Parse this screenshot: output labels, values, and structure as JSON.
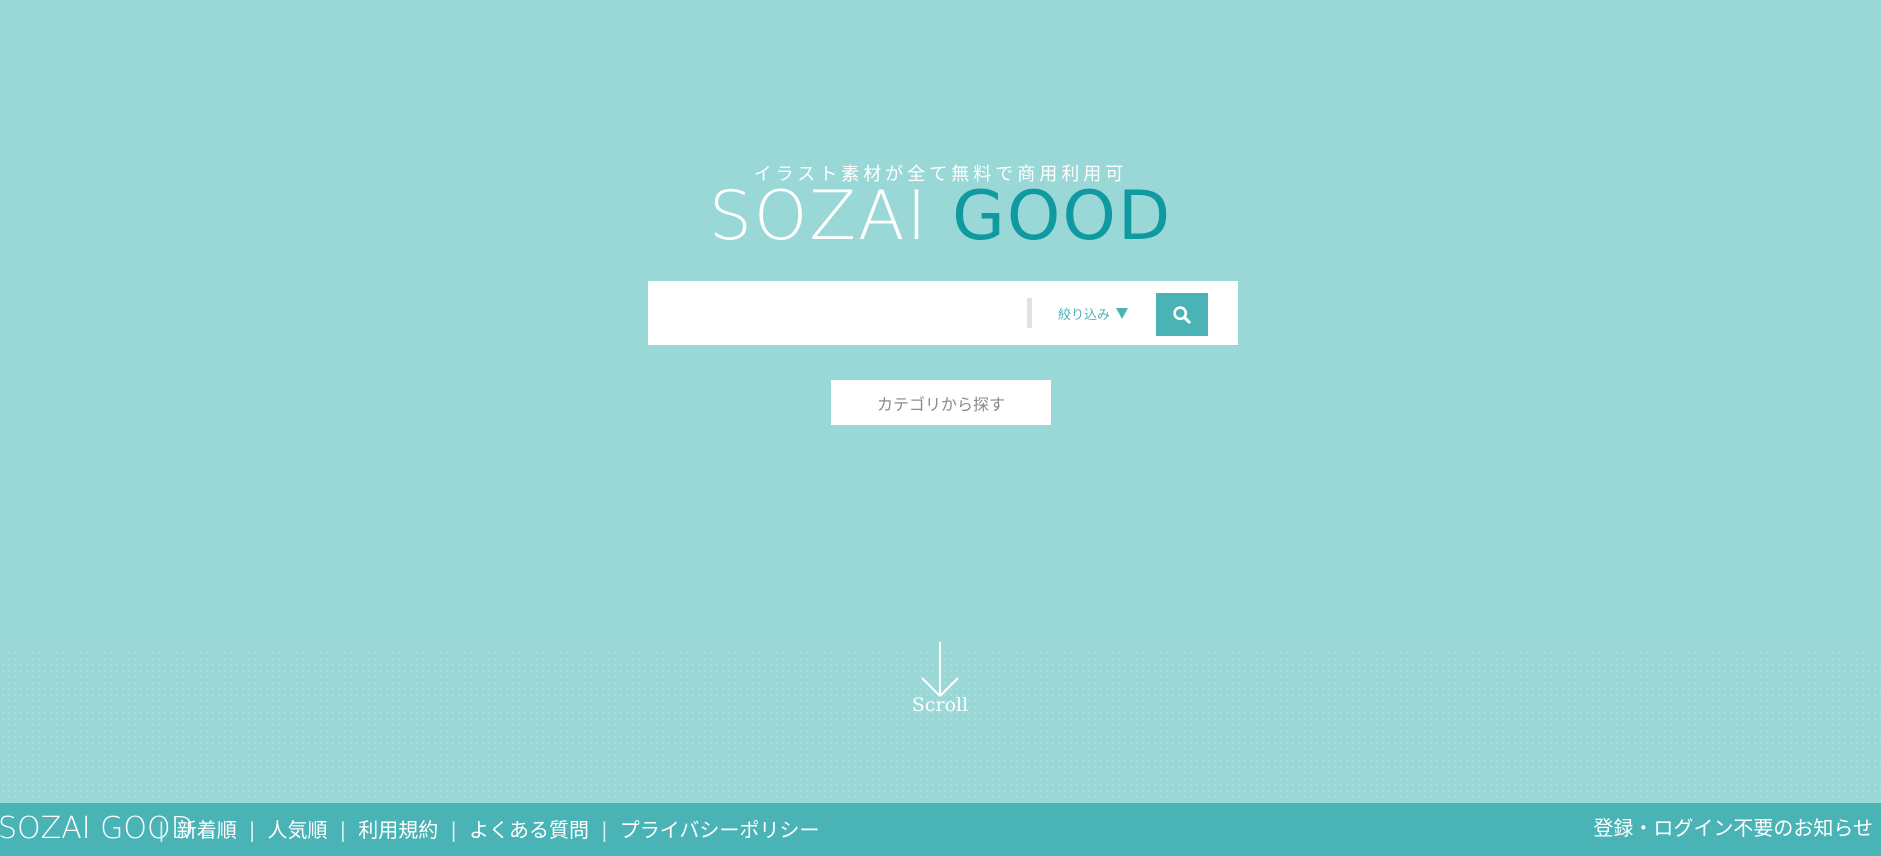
{
  "hero": {
    "tagline": "イラスト素材が全て無料で商用利用可",
    "logo_part1": "SOZAI",
    "logo_part2": "GOOD"
  },
  "search": {
    "input_value": "",
    "input_placeholder": "",
    "filter_label": "絞り込み",
    "button_icon": "search-icon"
  },
  "category_button_label": "カテゴリから探す",
  "scroll_label": "Scroll",
  "footer": {
    "logo": "SOZAI GOOD",
    "nav": [
      "新着順",
      "人気順",
      "利用規約",
      "よくある質問",
      "プライバシーポリシー"
    ],
    "notice": "登録・ログイン不要のお知らせ"
  },
  "colors": {
    "background": "#9ad8d7",
    "accent": "#4ab3b6",
    "logo_dark": "#0e9aa0",
    "white": "#ffffff"
  }
}
